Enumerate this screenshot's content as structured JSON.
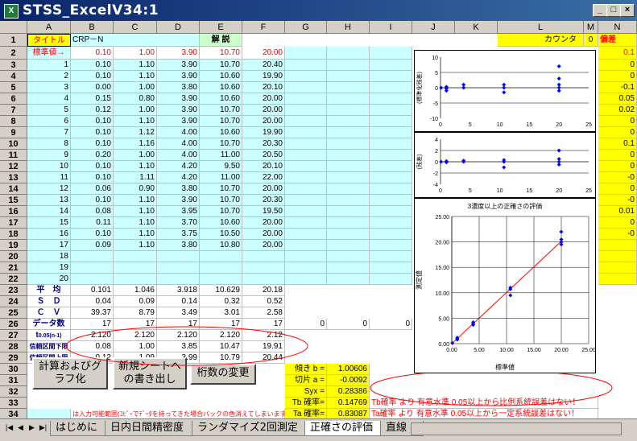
{
  "window": {
    "title": "STSS_ExcelV34:1",
    "app_icon": "excel-icon"
  },
  "columns": [
    "A",
    "B",
    "C",
    "D",
    "E",
    "F",
    "G",
    "H",
    "I",
    "J",
    "K",
    "L",
    "M",
    "N"
  ],
  "rows": [
    "1",
    "2",
    "3",
    "4",
    "5",
    "6",
    "7",
    "8",
    "9",
    "10",
    "11",
    "12",
    "13",
    "14",
    "15",
    "16",
    "17",
    "18",
    "19",
    "20",
    "21",
    "22",
    "23",
    "24",
    "25",
    "26",
    "27",
    "28",
    "29",
    "30",
    "31",
    "32",
    "33",
    "34",
    "35",
    "36"
  ],
  "header_row": {
    "title_label": "タイトル",
    "title_value": "CRP－N",
    "kaisetsu": "解 説",
    "counter_label": "カウンタ",
    "counter_value": "0",
    "bias_label": "偏差"
  },
  "standard_row": {
    "label": "標準値→",
    "values": [
      "0.10",
      "1.00",
      "3.90",
      "10.70",
      "20.00"
    ]
  },
  "data_rows": [
    {
      "n": "1",
      "v": [
        "0.10",
        "1.10",
        "3.90",
        "10.70",
        "20.40"
      ]
    },
    {
      "n": "2",
      "v": [
        "0.10",
        "1.10",
        "3.90",
        "10.60",
        "19.90"
      ]
    },
    {
      "n": "3",
      "v": [
        "0.00",
        "1.00",
        "3.80",
        "10.60",
        "20.10"
      ]
    },
    {
      "n": "4",
      "v": [
        "0.15",
        "0.80",
        "3.90",
        "10.60",
        "20.00"
      ]
    },
    {
      "n": "5",
      "v": [
        "0.12",
        "1.00",
        "3.90",
        "10.70",
        "20.00"
      ]
    },
    {
      "n": "6",
      "v": [
        "0.10",
        "1.10",
        "3.90",
        "10.70",
        "20.00"
      ]
    },
    {
      "n": "7",
      "v": [
        "0.10",
        "1.12",
        "4.00",
        "10.60",
        "19.90"
      ]
    },
    {
      "n": "8",
      "v": [
        "0.10",
        "1.16",
        "4.00",
        "10.70",
        "20.30"
      ]
    },
    {
      "n": "9",
      "v": [
        "0.20",
        "1.00",
        "4.00",
        "11.00",
        "20.50"
      ]
    },
    {
      "n": "10",
      "v": [
        "0.10",
        "1.10",
        "4.20",
        "9.50",
        "20.10"
      ]
    },
    {
      "n": "11",
      "v": [
        "0.10",
        "1.11",
        "4.20",
        "11.00",
        "22.00"
      ]
    },
    {
      "n": "12",
      "v": [
        "0.06",
        "0.90",
        "3.80",
        "10.70",
        "20.00"
      ]
    },
    {
      "n": "13",
      "v": [
        "0.10",
        "1.10",
        "3.90",
        "10.70",
        "20.30"
      ]
    },
    {
      "n": "14",
      "v": [
        "0.08",
        "1.10",
        "3.95",
        "10.70",
        "19.50"
      ]
    },
    {
      "n": "15",
      "v": [
        "0.11",
        "1.10",
        "3.70",
        "10.60",
        "20.00"
      ]
    },
    {
      "n": "16",
      "v": [
        "0.10",
        "1.10",
        "3.75",
        "10.50",
        "20.00"
      ]
    },
    {
      "n": "17",
      "v": [
        "0.09",
        "1.10",
        "3.80",
        "10.80",
        "20.00"
      ]
    },
    {
      "n": "18",
      "v": [
        "",
        "",
        "",
        "",
        ""
      ]
    },
    {
      "n": "19",
      "v": [
        "",
        "",
        "",
        "",
        ""
      ]
    },
    {
      "n": "20",
      "v": [
        "",
        "",
        "",
        "",
        ""
      ]
    }
  ],
  "stats": [
    {
      "label": "平　均",
      "v": [
        "0.101",
        "1.046",
        "3.918",
        "10.629",
        "20.18"
      ]
    },
    {
      "label": "Ｓ　Ｄ",
      "v": [
        "0.04",
        "0.09",
        "0.14",
        "0.32",
        "0.52"
      ]
    },
    {
      "label": "Ｃ　Ｖ",
      "v": [
        "39.37",
        "8.79",
        "3.49",
        "3.01",
        "2.58"
      ]
    },
    {
      "label": "データ数",
      "v": [
        "17",
        "17",
        "17",
        "17",
        "17"
      ],
      "extra": [
        "0",
        "0",
        "0"
      ]
    },
    {
      "label": "t",
      "sub": "0.05(n-1)",
      "v": [
        "2.120",
        "2.120",
        "2.120",
        "2.120",
        "2.12"
      ]
    },
    {
      "label": "信頼区間下限",
      "v": [
        "0.08",
        "1.00",
        "3.85",
        "10.47",
        "19.91"
      ]
    },
    {
      "label": "信頼区間上限",
      "v": [
        "0.12",
        "1.09",
        "3.99",
        "10.79",
        "20.44"
      ]
    }
  ],
  "regression": [
    {
      "label": "傾き b =",
      "value": "1.00606"
    },
    {
      "label": "切片 a =",
      "value": "-0.0092"
    },
    {
      "label": "Syx =",
      "value": "0.28386"
    },
    {
      "label": "Tb 確率=",
      "value": "0.14769"
    },
    {
      "label": "Ta 確率=",
      "value": "0.83087"
    }
  ],
  "messages": {
    "tb": "Tb確率  より 有意水準 0.05以上から比例系統誤差はない！",
    "ta": "Ta確率  より 有意水準 0.05以上から一定系統誤差はない！",
    "note": "は入力可能範囲(ｺﾋﾟｰでﾃﾞｰﾀを持ってきた場合バックの色消えてしまいますの"
  },
  "buttons": {
    "calc": "計算およびグラフ化",
    "new_sheet": "新規シートへの書き出し",
    "digits": "桁数の変更"
  },
  "col_n_values": [
    "0.1",
    "0",
    "0",
    "-0.1",
    "0.05",
    "0.02",
    "0",
    "0",
    "0.1",
    "0",
    "0",
    "-0",
    "0",
    "-0",
    "0.01",
    "0",
    "-0",
    "",
    "",
    "",
    "",
    "0"
  ],
  "charts": {
    "top": {
      "ylabel": "(標準化残差)",
      "yticks": [
        "10",
        "5",
        "0",
        "-5",
        "-10"
      ],
      "xticks": [
        "0",
        "5",
        "10",
        "15",
        "20",
        "25"
      ]
    },
    "mid": {
      "ylabel": "(残差)",
      "yticks": [
        "4",
        "2",
        "0",
        "-2",
        "-4"
      ],
      "xticks": [
        "0",
        "5",
        "10",
        "15",
        "20",
        "25"
      ]
    },
    "main": {
      "title": "3濃度以上の正確さの評価",
      "ylabel": "測定値",
      "xlabel": "標準値",
      "yticks": [
        "25.00",
        "20.00",
        "15.00",
        "10.00",
        "5.00",
        "0.00"
      ],
      "xticks": [
        "0.00",
        "5.00",
        "10.00",
        "15.00",
        "20.00",
        "25.00"
      ]
    }
  },
  "chart_data": [
    {
      "type": "scatter",
      "title": "",
      "xlabel": "",
      "ylabel": "(標準化残差)",
      "xlim": [
        0,
        25
      ],
      "ylim": [
        -10,
        10
      ],
      "series": [
        {
          "values": [
            {
              "x": 0.1,
              "y": 0
            },
            {
              "x": 1,
              "y": 0.3
            },
            {
              "x": 1,
              "y": -0.3
            },
            {
              "x": 1,
              "y": -1
            },
            {
              "x": 3.9,
              "y": 0
            },
            {
              "x": 3.9,
              "y": 1
            },
            {
              "x": 10.7,
              "y": 0
            },
            {
              "x": 10.7,
              "y": 1
            },
            {
              "x": 10.7,
              "y": -1.5
            },
            {
              "x": 20,
              "y": 0
            },
            {
              "x": 20,
              "y": 1
            },
            {
              "x": 20,
              "y": -1
            },
            {
              "x": 20,
              "y": 3
            },
            {
              "x": 20,
              "y": 7
            }
          ]
        }
      ]
    },
    {
      "type": "scatter",
      "title": "",
      "xlabel": "",
      "ylabel": "(残差)",
      "xlim": [
        0,
        25
      ],
      "ylim": [
        -4,
        4
      ],
      "series": [
        {
          "values": [
            {
              "x": 0.1,
              "y": 0
            },
            {
              "x": 1,
              "y": 0.1
            },
            {
              "x": 1,
              "y": -0.1
            },
            {
              "x": 3.9,
              "y": 0
            },
            {
              "x": 3.9,
              "y": 0.2
            },
            {
              "x": 10.7,
              "y": 0
            },
            {
              "x": 10.7,
              "y": 0.3
            },
            {
              "x": 10.7,
              "y": -1
            },
            {
              "x": 20,
              "y": 0
            },
            {
              "x": 20,
              "y": 0.5
            },
            {
              "x": 20,
              "y": -0.5
            },
            {
              "x": 20,
              "y": 2
            }
          ]
        }
      ]
    },
    {
      "type": "scatter",
      "title": "3濃度以上の正確さの評価",
      "xlabel": "標準値",
      "ylabel": "測定値",
      "xlim": [
        0,
        25
      ],
      "ylim": [
        0,
        25
      ],
      "series": [
        {
          "values": [
            {
              "x": 0.1,
              "y": 0.1
            },
            {
              "x": 1,
              "y": 1
            },
            {
              "x": 1,
              "y": 1.16
            },
            {
              "x": 1,
              "y": 0.8
            },
            {
              "x": 3.9,
              "y": 3.9
            },
            {
              "x": 3.9,
              "y": 4.2
            },
            {
              "x": 3.9,
              "y": 3.7
            },
            {
              "x": 10.7,
              "y": 10.7
            },
            {
              "x": 10.7,
              "y": 11
            },
            {
              "x": 10.7,
              "y": 9.5
            },
            {
              "x": 20,
              "y": 20
            },
            {
              "x": 20,
              "y": 20.5
            },
            {
              "x": 20,
              "y": 22
            },
            {
              "x": 20,
              "y": 19.5
            }
          ]
        }
      ],
      "line": {
        "slope": 1.00606,
        "intercept": -0.0092
      }
    }
  ],
  "tabs": [
    "はじめに",
    "日内日間精密度",
    "ランダマイズ2回測定",
    "正確さの評価",
    "直線"
  ],
  "colors": {
    "yellow": "#ffff00",
    "cyan": "#ccffff",
    "lightgreen": "#ccffcc",
    "red": "#ff0000",
    "blue": "#0000ff",
    "navy": "#000080"
  }
}
